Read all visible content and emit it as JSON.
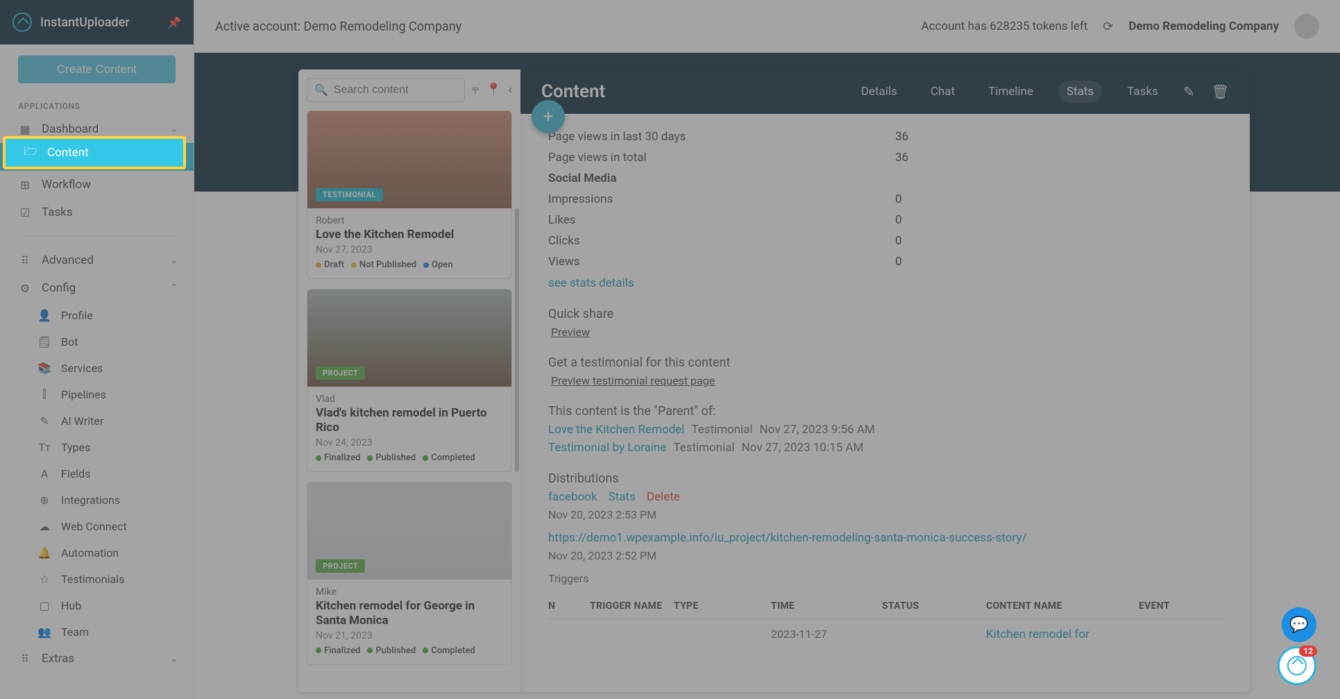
{
  "brand": "InstantUploader",
  "create_button": "Create Content",
  "sidebar": {
    "section_applications": "APPLICATIONS",
    "items": [
      {
        "label": "Dashboard",
        "icon": "▦",
        "expandable": true
      },
      {
        "label": "Content",
        "icon": "🗁",
        "active": true
      },
      {
        "label": "Workflow",
        "icon": "⊞"
      },
      {
        "label": "Tasks",
        "icon": "☑"
      }
    ],
    "advanced": {
      "label": "Advanced",
      "icon": "⠿"
    },
    "config": {
      "label": "Config",
      "icon": "⚙"
    },
    "config_items": [
      {
        "label": "Profile",
        "icon": "👤"
      },
      {
        "label": "Bot",
        "icon": "🗒"
      },
      {
        "label": "Services",
        "icon": "📚"
      },
      {
        "label": "Pipelines",
        "icon": "⫿"
      },
      {
        "label": "AI Writer",
        "icon": "✎"
      },
      {
        "label": "Types",
        "icon": "Tт"
      },
      {
        "label": "Fields",
        "icon": "A"
      },
      {
        "label": "Integrations",
        "icon": "⊕"
      },
      {
        "label": "Web Connect",
        "icon": "☁"
      },
      {
        "label": "Automation",
        "icon": "🔔"
      },
      {
        "label": "Testimonials",
        "icon": "☆"
      },
      {
        "label": "Hub",
        "icon": "▢"
      },
      {
        "label": "Team",
        "icon": "👥"
      }
    ],
    "extras": {
      "label": "Extras",
      "icon": "⠿"
    }
  },
  "topbar": {
    "active_account_label": "Active account: ",
    "active_account_name": "Demo Remodeling Company",
    "tokens_text": "Account has 628235 tokens left",
    "company": "Demo Remodeling Company"
  },
  "list": {
    "search_placeholder": "Search content",
    "cards": [
      {
        "badge": "TESTIMONIAL",
        "badge_class": "testimonial",
        "img": "img1",
        "author": "Robert",
        "title": "Love the Kitchen Remodel",
        "date": "Nov 27, 2023",
        "statuses": [
          {
            "dot": "orange",
            "text": "Draft"
          },
          {
            "dot": "yellow",
            "text": "Not Published"
          },
          {
            "dot": "blue",
            "text": "Open"
          }
        ]
      },
      {
        "badge": "PROJECT",
        "badge_class": "project",
        "img": "img2",
        "author": "Vlad",
        "title": "Vlad's kitchen remodel in Puerto Rico",
        "date": "Nov 24, 2023",
        "statuses": [
          {
            "dot": "green",
            "text": "Finalized"
          },
          {
            "dot": "green",
            "text": "Published"
          },
          {
            "dot": "green",
            "text": "Completed"
          }
        ]
      },
      {
        "badge": "PROJECT",
        "badge_class": "project",
        "img": "img3",
        "author": "Mike",
        "title": "Kitchen remodel for George in Santa Monica",
        "date": "Nov 21, 2023",
        "statuses": [
          {
            "dot": "green",
            "text": "Finalized"
          },
          {
            "dot": "green",
            "text": "Published"
          },
          {
            "dot": "green",
            "text": "Completed"
          }
        ]
      }
    ]
  },
  "detail": {
    "title": "Content",
    "tabs": [
      "Details",
      "Chat",
      "Timeline",
      "Stats",
      "Tasks"
    ],
    "active_tab": "Stats",
    "stats": [
      {
        "label": "Page views in last 30 days",
        "value": "36"
      },
      {
        "label": "Page views in total",
        "value": "36"
      },
      {
        "label": "Social Media",
        "value": "",
        "bold": true
      },
      {
        "label": "Impressions",
        "value": "0"
      },
      {
        "label": "Likes",
        "value": "0"
      },
      {
        "label": "Clicks",
        "value": "0"
      },
      {
        "label": "Views",
        "value": "0"
      }
    ],
    "see_stats": "see stats details",
    "quick_share_h": "Quick share",
    "preview": "Preview",
    "testimonial_h": "Get a testimonial for this content",
    "preview_testimonial": "Preview testimonial request page",
    "parent_h": "This content is the \"Parent\" of:",
    "children": [
      {
        "name": "Love the Kitchen Remodel",
        "type": "Testimonial",
        "date": "Nov 27, 2023 9:56 AM"
      },
      {
        "name": "Testimonial by Loraine",
        "type": "Testimonial",
        "date": "Nov 27, 2023 10:15 AM"
      }
    ],
    "distributions_h": "Distributions",
    "dist_fb": "facebook",
    "dist_stats": "Stats",
    "dist_delete": "Delete",
    "dist_date1": "Nov 20, 2023 2:53 PM",
    "dist_url": "https://demo1.wpexample.info/iu_project/kitchen-remodeling-santa-monica-success-story/",
    "dist_date2": "Nov 20, 2023 2:52 PM",
    "triggers_h": "Triggers",
    "trigger_cols": {
      "n": "N",
      "name": "TRIGGER NAME",
      "type": "TYPE",
      "time": "TIME",
      "status": "STATUS",
      "content": "CONTENT NAME",
      "event": "EVENT"
    },
    "trigger_row": {
      "time": "2023-11-27",
      "content": "Kitchen remodel for"
    }
  },
  "help_badge": "12"
}
